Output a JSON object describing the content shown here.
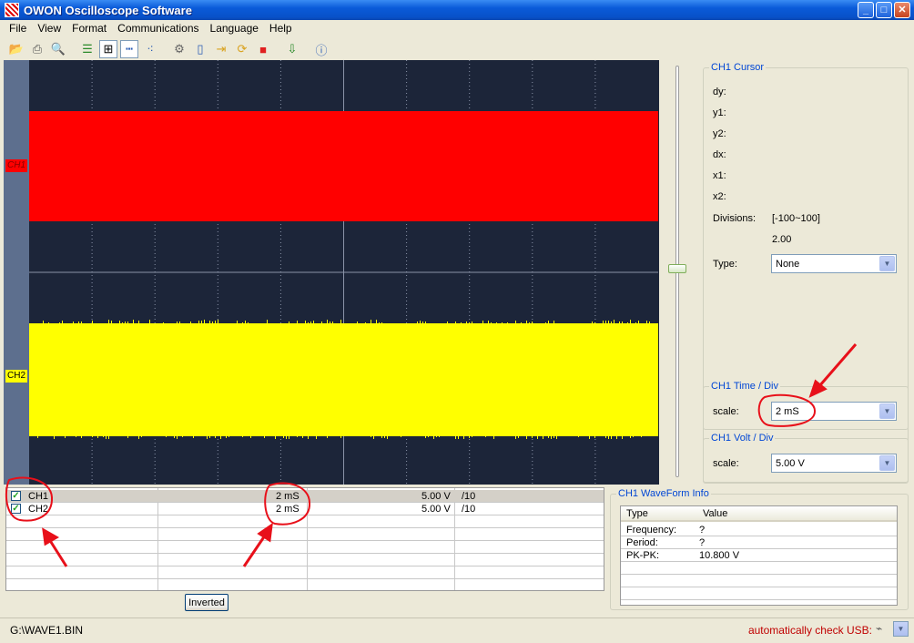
{
  "window": {
    "title": "OWON Oscilloscope Software"
  },
  "menu": [
    "File",
    "View",
    "Format",
    "Communications",
    "Language",
    "Help"
  ],
  "toolbar_icons": [
    "open-icon",
    "print-icon",
    "print-preview-icon",
    "list-icon",
    "grid-icon",
    "dots-icon",
    "xy-icon",
    "settings-icon",
    "usb-device-icon",
    "import-icon",
    "refresh-icon",
    "stop-icon",
    "export-icon",
    "help-icon"
  ],
  "scope": {
    "ch1_label": "CH1",
    "ch2_label": "CH2",
    "colors": {
      "background": "#1c2539",
      "grid": "#8a93a8",
      "ch1": "#ff0000",
      "ch2": "#ffff00"
    }
  },
  "cursor_panel": {
    "title": "CH1 Cursor",
    "dy": "dy:",
    "y1": "y1:",
    "y2": "y2:",
    "dx": "dx:",
    "x1": "x1:",
    "x2": "x2:",
    "divisions_label": "Divisions:",
    "divisions_range": "[-100~100]",
    "divisions_value": "2.00",
    "type_label": "Type:",
    "type_value": "None"
  },
  "time_panel": {
    "title": "CH1 Time / Div",
    "scale_label": "scale:",
    "scale_value": "2  mS"
  },
  "volt_panel": {
    "title": "CH1 Volt / Div",
    "scale_label": "scale:",
    "scale_value": "5.00 V"
  },
  "channel_table": {
    "rows": [
      {
        "name": "CH1",
        "time": "2  mS",
        "volt": "5.00 V",
        "probe": "/10",
        "checked": true
      },
      {
        "name": "CH2",
        "time": "2  mS",
        "volt": "5.00 V",
        "probe": "/10",
        "checked": true
      }
    ]
  },
  "inverted_button": "Inverted",
  "waveform_info": {
    "title": "CH1 WaveForm Info",
    "header": {
      "type": "Type",
      "value": "Value"
    },
    "rows": [
      {
        "type": "Frequency:",
        "value": "?"
      },
      {
        "type": "Period:",
        "value": "?"
      },
      {
        "type": "PK-PK:",
        "value": "10.800 V"
      }
    ]
  },
  "status": {
    "path": "G:\\WAVE1.BIN",
    "usb_text": "automatically check USB:"
  }
}
